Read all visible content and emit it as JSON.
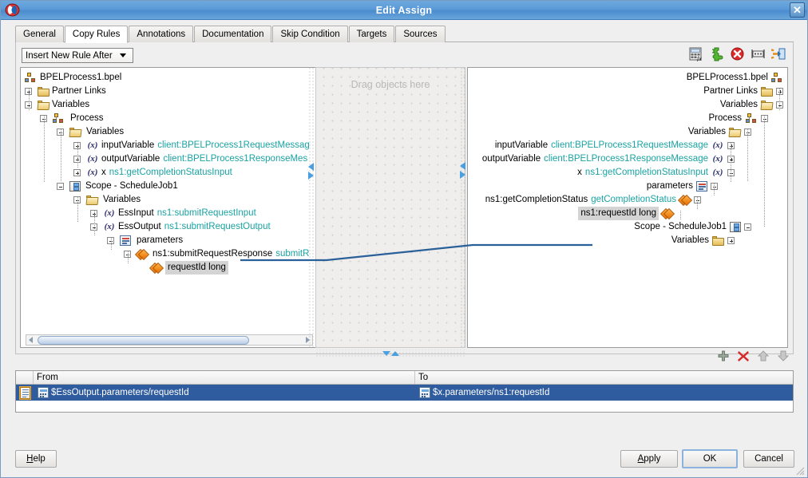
{
  "window": {
    "title": "Edit Assign",
    "app_icon": "oracle-jdeveloper-icon",
    "close_label": "✕"
  },
  "tabs": [
    {
      "label": "General",
      "selected": false
    },
    {
      "label": "Copy Rules",
      "selected": true
    },
    {
      "label": "Annotations",
      "selected": false
    },
    {
      "label": "Documentation",
      "selected": false
    },
    {
      "label": "Skip Condition",
      "selected": false
    },
    {
      "label": "Targets",
      "selected": false
    },
    {
      "label": "Sources",
      "selected": false
    }
  ],
  "toolbar": {
    "insert_combo_value": "Insert New Rule After",
    "icons": [
      {
        "name": "xpath-expression-icon",
        "title": "XPath Expression"
      },
      {
        "name": "add-function-icon",
        "title": "Add Function"
      },
      {
        "name": "delete-icon",
        "title": "Delete"
      },
      {
        "name": "ignore-missing-icon",
        "title": "Ignore Missing"
      },
      {
        "name": "insert-rule-icon",
        "title": "Insert Rule"
      }
    ]
  },
  "drop_panel": {
    "placeholder": "Drag objects here"
  },
  "left_tree": {
    "rows": [
      {
        "indent": 0,
        "exp": "none",
        "icon": "bpel-process-icon",
        "name": "BPELProcess1.bpel",
        "type": ""
      },
      {
        "indent": 1,
        "exp": "plus",
        "icon": "folder-icon",
        "name": "Partner Links",
        "type": ""
      },
      {
        "indent": 1,
        "exp": "minus",
        "icon": "folder-open-icon",
        "name": "Variables",
        "type": ""
      },
      {
        "indent": 2,
        "exp": "minus",
        "icon": "process-icon",
        "name": "Process",
        "type": ""
      },
      {
        "indent": 3,
        "exp": "minus",
        "icon": "folder-open-icon",
        "name": "Variables",
        "type": ""
      },
      {
        "indent": 4,
        "exp": "plus",
        "icon": "variable-icon",
        "name": "inputVariable",
        "type": "client:BPELProcess1RequestMessag"
      },
      {
        "indent": 4,
        "exp": "plus",
        "icon": "variable-icon",
        "name": "outputVariable",
        "type": "client:BPELProcess1ResponseMes"
      },
      {
        "indent": 4,
        "exp": "plus",
        "icon": "variable-icon",
        "name": "x",
        "type": "ns1:getCompletionStatusInput"
      },
      {
        "indent": 3,
        "exp": "minus",
        "icon": "scope-icon",
        "name": "Scope - ScheduleJob1",
        "type": ""
      },
      {
        "indent": 4,
        "exp": "minus",
        "icon": "folder-open-icon",
        "name": "Variables",
        "type": ""
      },
      {
        "indent": 5,
        "exp": "plus",
        "icon": "variable-icon",
        "name": "EssInput",
        "type": "ns1:submitRequestInput"
      },
      {
        "indent": 5,
        "exp": "minus",
        "icon": "variable-icon",
        "name": "EssOutput",
        "type": "ns1:submitRequestOutput"
      },
      {
        "indent": 6,
        "exp": "minus",
        "icon": "parameters-icon",
        "name": "parameters",
        "type": ""
      },
      {
        "indent": 7,
        "exp": "minus",
        "icon": "element-icon",
        "name": "ns1:submitRequestResponse",
        "type": "submitR"
      },
      {
        "indent": 8,
        "exp": "none",
        "icon": "element-icon",
        "name": "requestId long",
        "type": "",
        "highlight": true
      }
    ]
  },
  "right_tree": {
    "rows": [
      {
        "level": 0,
        "exp": "none",
        "icon": "bpel-process-icon",
        "name": "BPELProcess1.bpel",
        "type": ""
      },
      {
        "level": 1,
        "exp": "plus",
        "icon": "folder-icon",
        "name": "Partner Links",
        "type": ""
      },
      {
        "level": 2,
        "exp": "minus",
        "icon": "folder-open-icon",
        "name": "Variables",
        "type": ""
      },
      {
        "level": 3,
        "exp": "minus",
        "icon": "process-icon",
        "name": "Process",
        "type": ""
      },
      {
        "level": 4,
        "exp": "minus",
        "icon": "folder-open-icon",
        "name": "Variables",
        "type": ""
      },
      {
        "level": 5,
        "exp": "plus",
        "icon": "variable-icon",
        "name": "inputVariable",
        "type": "client:BPELProcess1RequestMessage"
      },
      {
        "level": 5,
        "exp": "plus",
        "icon": "variable-icon",
        "name": "outputVariable",
        "type": "client:BPELProcess1ResponseMessage"
      },
      {
        "level": 5,
        "exp": "minus",
        "icon": "variable-icon",
        "name": "x",
        "type": "ns1:getCompletionStatusInput"
      },
      {
        "level": 6,
        "exp": "minus",
        "icon": "parameters-icon",
        "name": "parameters",
        "type": ""
      },
      {
        "level": 7,
        "exp": "minus",
        "icon": "element-icon",
        "name": "ns1:getCompletionStatus",
        "type": "getCompletionStatus"
      },
      {
        "level": 8,
        "exp": "none",
        "icon": "element-icon",
        "name": "ns1:requestId long",
        "type": "",
        "highlight": true
      },
      {
        "level": 4,
        "exp": "minus",
        "icon": "scope-icon",
        "name": "Scope - ScheduleJob1",
        "type": ""
      },
      {
        "level": 5,
        "exp": "plus",
        "icon": "folder-icon",
        "name": "Variables",
        "type": ""
      }
    ]
  },
  "row_actions": [
    {
      "name": "add-rule-icon",
      "glyph": "+"
    },
    {
      "name": "delete-rule-icon",
      "glyph": "✖"
    },
    {
      "name": "move-up-icon",
      "glyph": "⇧"
    },
    {
      "name": "move-down-icon",
      "glyph": "⇩"
    }
  ],
  "table": {
    "columns": [
      "From",
      "To"
    ],
    "rows": [
      {
        "from": "$EssOutput.parameters/requestId",
        "to": "$x.parameters/ns1:requestId",
        "selected": true
      }
    ]
  },
  "buttons": {
    "help": {
      "label": "Help",
      "mnemonic": "H"
    },
    "apply": {
      "label": "Apply",
      "mnemonic": "A"
    },
    "ok": {
      "label": "OK",
      "default": true
    },
    "cancel": {
      "label": "Cancel"
    }
  },
  "colors": {
    "titlebar": "#5b9ad8",
    "type_text": "#1aa3a3",
    "selection": "#2f5c9e",
    "connector": "#2a6099",
    "highlight": "#d4d4d4"
  }
}
